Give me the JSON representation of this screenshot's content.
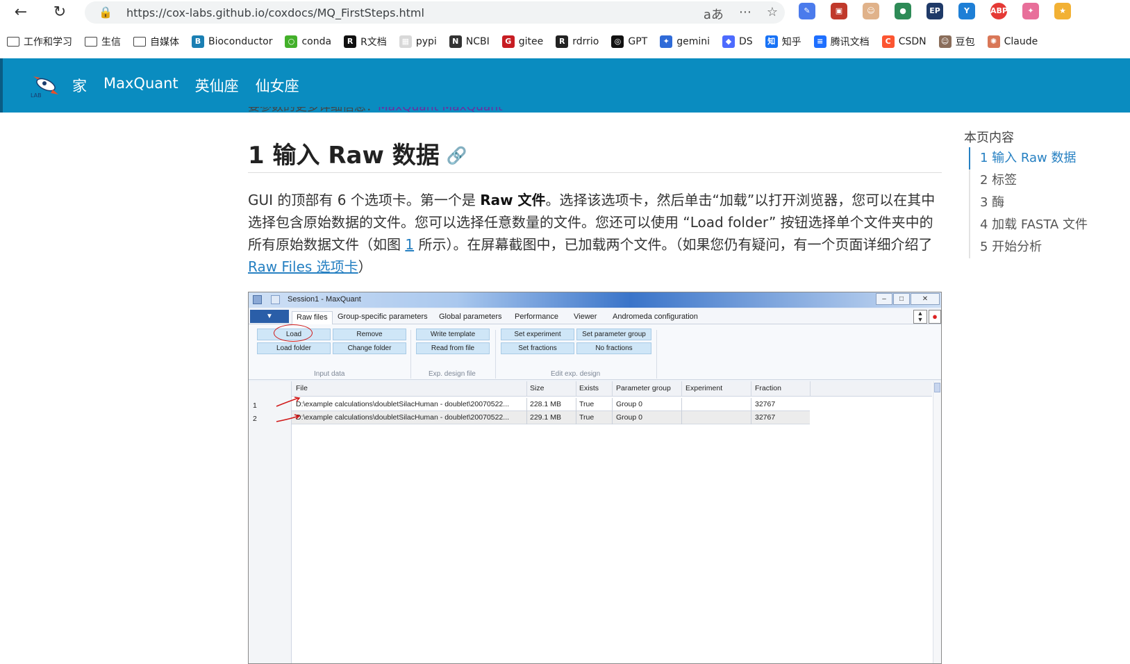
{
  "browser": {
    "url": "https://cox-labs.github.io/coxdocs/MQ_FirstSteps.html",
    "bookmarks": [
      {
        "label": "工作和学习",
        "icon": "folder-icon",
        "color": ""
      },
      {
        "label": "生信",
        "icon": "folder-icon",
        "color": ""
      },
      {
        "label": "自媒体",
        "icon": "folder-icon",
        "color": ""
      },
      {
        "label": "Bioconductor",
        "icon": "bioconductor-icon",
        "color": "#1a7fb3"
      },
      {
        "label": "conda",
        "icon": "conda-icon",
        "color": "#43b02a"
      },
      {
        "label": "R文档",
        "icon": "r-icon",
        "color": "#111111"
      },
      {
        "label": "pypi",
        "icon": "pypi-icon",
        "color": "#d8d8d8"
      },
      {
        "label": "NCBI",
        "icon": "ncbi-icon",
        "color": "#333333"
      },
      {
        "label": "gitee",
        "icon": "gitee-icon",
        "color": "#c71d23"
      },
      {
        "label": "rdrrio",
        "icon": "r-icon",
        "color": "#222222"
      },
      {
        "label": "GPT",
        "icon": "openai-icon",
        "color": "#111111"
      },
      {
        "label": "gemini",
        "icon": "gemini-icon",
        "color": "#2f6bd8"
      },
      {
        "label": "DS",
        "icon": "deepseek-icon",
        "color": "#4d6bfe"
      },
      {
        "label": "知乎",
        "icon": "zhihu-icon",
        "color": "#1772f6"
      },
      {
        "label": "腾讯文档",
        "icon": "tencent-docs-icon",
        "color": "#1e6fff"
      },
      {
        "label": "CSDN",
        "icon": "csdn-icon",
        "color": "#fc5531"
      },
      {
        "label": "豆包",
        "icon": "doubao-icon",
        "color": "#8a6d5a"
      },
      {
        "label": "Claude",
        "icon": "claude-icon",
        "color": "#d97757"
      }
    ]
  },
  "site": {
    "nav": [
      "家",
      "MaxQuant",
      "英仙座",
      "仙女座"
    ],
    "brand_color": "#0a8cc0",
    "logo_text": "LAB"
  },
  "content": {
    "prev_line_text": "要参数的更多详细信息：",
    "prev_line_link": "MaxQuant MaxQuant",
    "heading": "1 输入 Raw 数据",
    "para_1": "GUI 的顶部有 6 个选项卡。第一个是 ",
    "para_bold": "Raw 文件",
    "para_2": "。选择该选项卡，然后单击“加载”以打开浏览器，您可以在其中选择包含原始数据的文件。您可以选择任意数量的文件。您还可以使用 “Load folder” 按钮选择单个文件夹中的所有原始数据文件（如图 ",
    "para_fig_link": "1",
    "para_3": " 所示）。在屏幕截图中，已加载两个文件。（如果您仍有疑问，有一个页面详细介绍了 ",
    "para_link": "Raw Files 选项卡",
    "para_4": "）"
  },
  "toc": {
    "title": "本页内容",
    "items": [
      "1 输入 Raw 数据",
      "2 标签",
      "3 酶",
      "4 加载 FASTA 文件",
      "5 开始分析"
    ],
    "active_index": 0
  },
  "maxquant": {
    "window_title": "Session1 - MaxQuant",
    "tabs": [
      "Raw files",
      "Group-specific parameters",
      "Global parameters",
      "Performance",
      "Viewer",
      "Andromeda configuration"
    ],
    "buttons": {
      "load": "Load",
      "remove": "Remove",
      "load_folder": "Load folder",
      "change_folder": "Change folder",
      "write_template": "Write template",
      "read_from_file": "Read from file",
      "set_experiment": "Set experiment",
      "set_parameter_group": "Set parameter group",
      "set_fractions": "Set fractions",
      "no_fractions": "No fractions"
    },
    "groups": [
      "Input data",
      "Exp. design file",
      "Edit exp. design"
    ],
    "columns": [
      "File",
      "Size",
      "Exists",
      "Parameter group",
      "Experiment",
      "Fraction"
    ],
    "rows": [
      {
        "num": "1",
        "file": "D:\\example calculations\\doubletSilacHuman - doublet\\20070522...",
        "size": "228.1 MB",
        "exists": "True",
        "group": "Group 0",
        "experiment": "",
        "fraction": "32767"
      },
      {
        "num": "2",
        "file": "D:\\example calculations\\doubletSilacHuman - doublet\\20070522...",
        "size": "229.1 MB",
        "exists": "True",
        "group": "Group 0",
        "experiment": "",
        "fraction": "32767"
      }
    ]
  }
}
